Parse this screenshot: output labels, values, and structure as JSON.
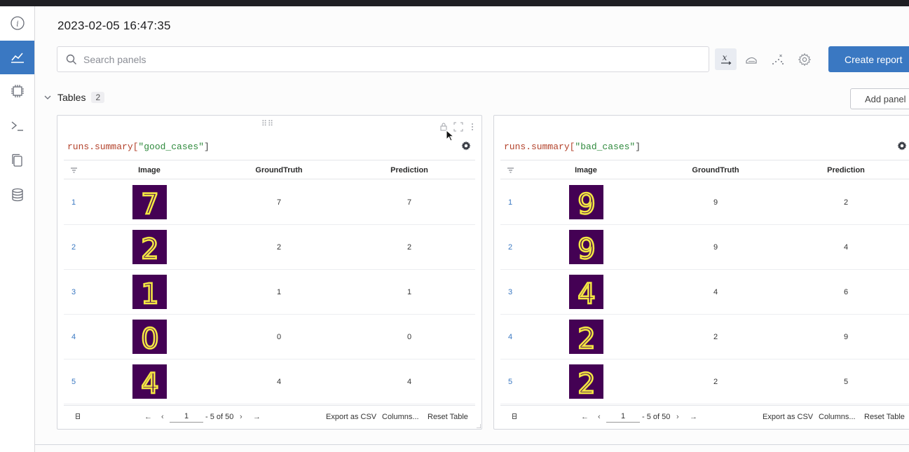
{
  "header": {
    "timestamp": "2023-02-05 16:47:35"
  },
  "sidebar": {
    "items": [
      {
        "icon": "info-icon"
      },
      {
        "icon": "line-chart-icon",
        "active": true
      },
      {
        "icon": "chip-icon"
      },
      {
        "icon": "terminal-icon"
      },
      {
        "icon": "files-icon"
      },
      {
        "icon": "database-icon"
      }
    ]
  },
  "search": {
    "placeholder": "Search panels",
    "value": ""
  },
  "toolbar": {
    "create_report_label": "Create report",
    "icons": [
      "x-axis-icon",
      "smoothing-icon",
      "outliers-icon",
      "settings-icon"
    ]
  },
  "section": {
    "title": "Tables",
    "count": "2",
    "add_panel_label": "Add panel"
  },
  "panels": [
    {
      "title_prefix": "runs.summary[",
      "title_key": "\"good_cases\"",
      "title_suffix": "]",
      "columns": [
        "Image",
        "GroundTruth",
        "Prediction"
      ],
      "rows": [
        {
          "index": "1",
          "digit": "7",
          "ground_truth": "7",
          "prediction": "7"
        },
        {
          "index": "2",
          "digit": "2",
          "ground_truth": "2",
          "prediction": "2"
        },
        {
          "index": "3",
          "digit": "1",
          "ground_truth": "1",
          "prediction": "1"
        },
        {
          "index": "4",
          "digit": "0",
          "ground_truth": "0",
          "prediction": "0"
        },
        {
          "index": "5",
          "digit": "4",
          "ground_truth": "4",
          "prediction": "4"
        }
      ],
      "footer": {
        "page": "1",
        "range": "- 5 of 50",
        "export_label": "Export as CSV",
        "columns_label": "Columns...",
        "reset_label": "Reset Table"
      }
    },
    {
      "title_prefix": "runs.summary[",
      "title_key": "\"bad_cases\"",
      "title_suffix": "]",
      "columns": [
        "Image",
        "GroundTruth",
        "Prediction"
      ],
      "rows": [
        {
          "index": "1",
          "digit": "9",
          "ground_truth": "9",
          "prediction": "2"
        },
        {
          "index": "2",
          "digit": "9",
          "ground_truth": "9",
          "prediction": "4"
        },
        {
          "index": "3",
          "digit": "4",
          "ground_truth": "4",
          "prediction": "6"
        },
        {
          "index": "4",
          "digit": "2",
          "ground_truth": "2",
          "prediction": "9"
        },
        {
          "index": "5",
          "digit": "2",
          "ground_truth": "2",
          "prediction": "5"
        }
      ],
      "footer": {
        "page": "1",
        "range": "- 5 of 50",
        "export_label": "Export as CSV",
        "columns_label": "Columns...",
        "reset_label": "Reset Table"
      }
    }
  ],
  "colors": {
    "accent": "#3a78c2",
    "image_bg": "#440154",
    "digit_stroke": "#f4e842"
  }
}
